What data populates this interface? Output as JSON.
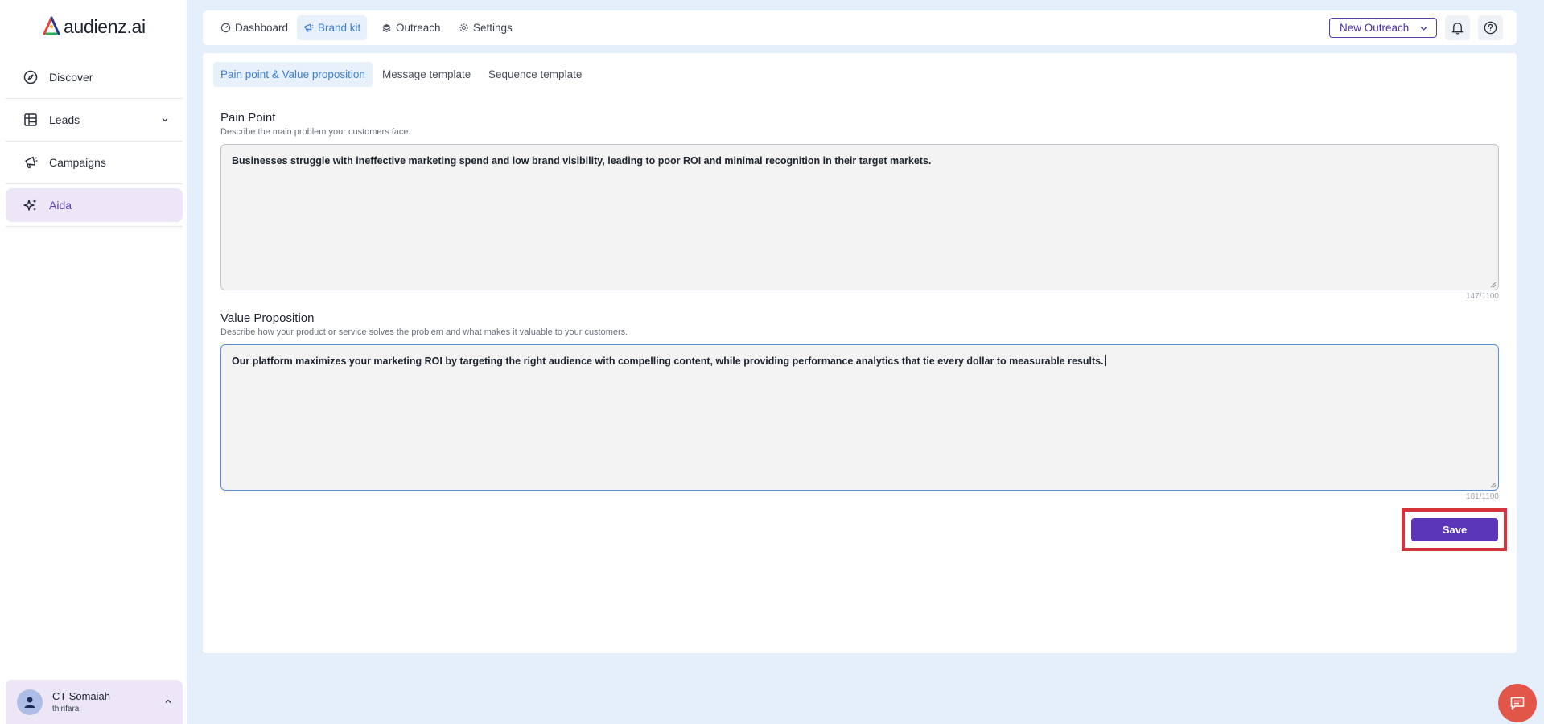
{
  "brand": {
    "name": "audienz.ai"
  },
  "sidebar": {
    "items": [
      {
        "label": "Discover",
        "icon": "compass-icon"
      },
      {
        "label": "Leads",
        "icon": "table-icon"
      },
      {
        "label": "Campaigns",
        "icon": "megaphone-icon"
      },
      {
        "label": "Aida",
        "icon": "sparkles-icon"
      }
    ],
    "active": "Aida"
  },
  "user": {
    "name": "CT Somaiah",
    "org": "thirifara"
  },
  "topbar": {
    "tabs": [
      {
        "label": "Dashboard",
        "icon": "gauge-icon"
      },
      {
        "label": "Brand kit",
        "icon": "megaphone-icon"
      },
      {
        "label": "Outreach",
        "icon": "layers-icon"
      },
      {
        "label": "Settings",
        "icon": "gear-icon"
      }
    ],
    "active_tab": "Brand kit",
    "new_outreach_label": "New Outreach"
  },
  "subtabs": {
    "items": [
      "Pain point & Value proposition",
      "Message template",
      "Sequence template"
    ],
    "active": "Pain point & Value proposition"
  },
  "pain_point": {
    "title": "Pain Point",
    "description": "Describe the main problem your customers face.",
    "value": "Businesses struggle with ineffective marketing spend and low brand visibility, leading to poor ROI and minimal recognition in their target markets.",
    "counter": "147/1100"
  },
  "value_proposition": {
    "title": "Value Proposition",
    "description": "Describe how your product or service solves the problem and what makes it valuable to your customers.",
    "value": "Our platform maximizes your marketing ROI by targeting the right audience with compelling content, while providing performance analytics that tie every dollar to measurable results.",
    "counter": "181/1100"
  },
  "save_label": "Save",
  "colors": {
    "accent": "#5b36b8",
    "link_blue": "#3d7fd6",
    "highlight": "#d6333b",
    "chat_fab": "#e2564a",
    "background": "#e4effb"
  }
}
